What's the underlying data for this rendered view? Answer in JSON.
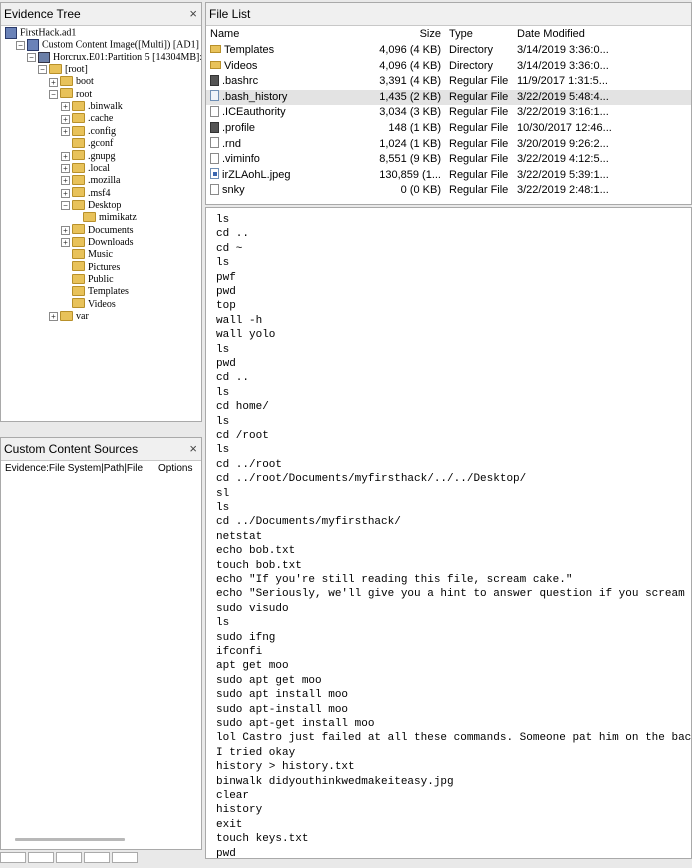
{
  "evidence_tree": {
    "title": "Evidence Tree",
    "close": "×",
    "nodes": [
      {
        "label": "FirstHack.ad1",
        "level": 0,
        "icon": "evidence-icon",
        "exp": ""
      },
      {
        "label": "Custom Content Image([Multi]) [AD1]",
        "level": 1,
        "icon": "image-icon",
        "exp": "−"
      },
      {
        "label": "Horcrux.E01:Partition 5 [14304MB]:NO",
        "level": 2,
        "icon": "disk-icon",
        "exp": "−"
      },
      {
        "label": "[root]",
        "level": 3,
        "icon": "folder-icon",
        "exp": "−"
      },
      {
        "label": "boot",
        "level": 4,
        "icon": "folder-icon",
        "exp": "+"
      },
      {
        "label": "root",
        "level": 4,
        "icon": "folder-icon",
        "exp": "−"
      },
      {
        "label": ".binwalk",
        "level": 5,
        "icon": "folder-icon",
        "exp": "+"
      },
      {
        "label": ".cache",
        "level": 5,
        "icon": "folder-icon",
        "exp": "+"
      },
      {
        "label": ".config",
        "level": 5,
        "icon": "folder-icon",
        "exp": "+"
      },
      {
        "label": ".gconf",
        "level": 5,
        "icon": "folder-icon",
        "exp": ""
      },
      {
        "label": ".gnupg",
        "level": 5,
        "icon": "folder-icon",
        "exp": "+"
      },
      {
        "label": ".local",
        "level": 5,
        "icon": "folder-icon",
        "exp": "+"
      },
      {
        "label": ".mozilla",
        "level": 5,
        "icon": "folder-icon",
        "exp": "+"
      },
      {
        "label": ".msf4",
        "level": 5,
        "icon": "folder-icon",
        "exp": "+"
      },
      {
        "label": "Desktop",
        "level": 5,
        "icon": "folder-icon",
        "exp": "−"
      },
      {
        "label": "mimikatz",
        "level": 6,
        "icon": "folder-icon",
        "exp": ""
      },
      {
        "label": "Documents",
        "level": 5,
        "icon": "folder-icon",
        "exp": "+"
      },
      {
        "label": "Downloads",
        "level": 5,
        "icon": "folder-icon",
        "exp": "+"
      },
      {
        "label": "Music",
        "level": 5,
        "icon": "folder-icon",
        "exp": ""
      },
      {
        "label": "Pictures",
        "level": 5,
        "icon": "folder-icon",
        "exp": ""
      },
      {
        "label": "Public",
        "level": 5,
        "icon": "folder-icon",
        "exp": ""
      },
      {
        "label": "Templates",
        "level": 5,
        "icon": "folder-icon",
        "exp": ""
      },
      {
        "label": "Videos",
        "level": 5,
        "icon": "folder-icon",
        "exp": ""
      },
      {
        "label": "var",
        "level": 4,
        "icon": "folder-icon",
        "exp": "+"
      }
    ]
  },
  "custom_content": {
    "title": "Custom Content Sources",
    "close": "×",
    "col_evidence": "Evidence:File System|Path|File",
    "col_options": "Options"
  },
  "file_list": {
    "title": "File List",
    "headers": {
      "name": "Name",
      "size": "Size",
      "type": "Type",
      "date": "Date Modified"
    },
    "rows": [
      {
        "name": "Templates",
        "size": "4,096 (4 KB)",
        "type": "Directory",
        "date": "3/14/2019 3:36:0...",
        "icon": "folder"
      },
      {
        "name": "Videos",
        "size": "4,096 (4 KB)",
        "type": "Directory",
        "date": "3/14/2019 3:36:0...",
        "icon": "folder"
      },
      {
        "name": ".bashrc",
        "size": "3,391 (4 KB)",
        "type": "Regular File",
        "date": "11/9/2017 1:31:5...",
        "icon": "dark"
      },
      {
        "name": ".bash_history",
        "size": "1,435 (2 KB)",
        "type": "Regular File",
        "date": "3/22/2019 5:48:4...",
        "icon": "txt",
        "selected": true
      },
      {
        "name": ".ICEauthority",
        "size": "3,034 (3 KB)",
        "type": "Regular File",
        "date": "3/22/2019 3:16:1...",
        "icon": "doc"
      },
      {
        "name": ".profile",
        "size": "148 (1 KB)",
        "type": "Regular File",
        "date": "10/30/2017 12:46...",
        "icon": "dark"
      },
      {
        "name": ".rnd",
        "size": "1,024 (1 KB)",
        "type": "Regular File",
        "date": "3/20/2019 9:26:2...",
        "icon": "doc"
      },
      {
        "name": ".viminfo",
        "size": "8,551 (9 KB)",
        "type": "Regular File",
        "date": "3/22/2019 4:12:5...",
        "icon": "doc"
      },
      {
        "name": "irZLAohL.jpeg",
        "size": "130,859 (1...",
        "type": "Regular File",
        "date": "3/22/2019 5:39:1...",
        "icon": "img"
      },
      {
        "name": "snky",
        "size": "0 (0 KB)",
        "type": "Regular File",
        "date": "3/22/2019 2:48:1...",
        "icon": "doc"
      }
    ]
  },
  "viewer": {
    "lines": [
      "ls",
      "cd ..",
      "cd ~",
      "ls",
      "pwf",
      "pwd",
      "top",
      "wall -h",
      "wall yolo",
      "ls",
      "pwd",
      "cd ..",
      "ls",
      "cd home/",
      "ls",
      "cd /root",
      "ls",
      "cd ../root",
      "cd ../root/Documents/myfirsthack/../../Desktop/",
      "sl",
      "ls",
      "cd ../Documents/myfirsthack/",
      "netstat",
      "echo bob.txt",
      "touch bob.txt",
      "echo \"If you're still reading this file, scream cake.\"",
      "echo \"Seriously, we'll give you a hint to answer question if you scream cake.\"",
      "sudo visudo",
      "ls",
      "sudo ifng",
      "ifconfi",
      "apt get moo",
      "sudo apt get moo",
      "sudo apt install moo",
      "sudo apt-install moo",
      "sudo apt-get install moo",
      "lol Castro just failed at all these commands. Someone pat him on the back.",
      "I tried okay",
      "history > history.txt",
      "binwalk didyouthinkwedmakeiteasy.jpg",
      "clear",
      "history",
      "exit",
      "touch keys.txt",
      "pwd"
    ]
  }
}
